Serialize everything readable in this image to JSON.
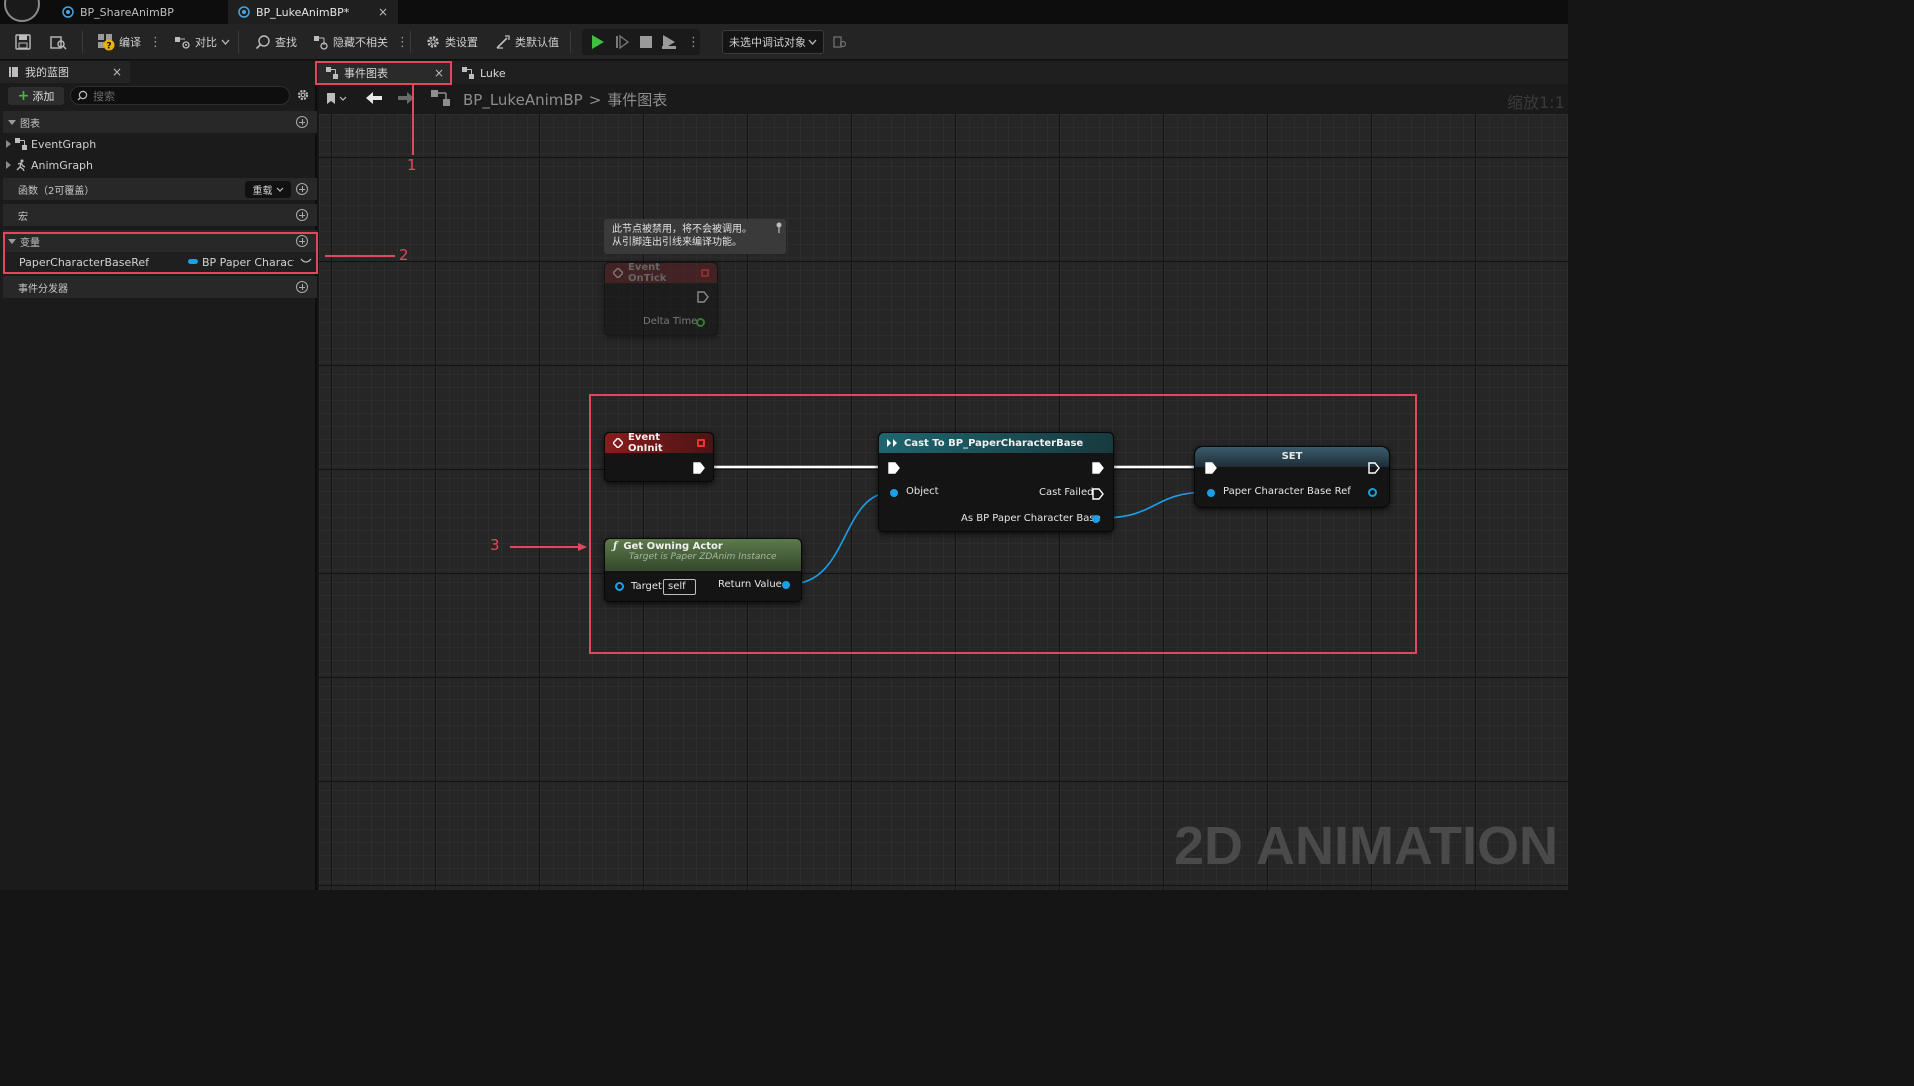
{
  "titlebar": {
    "tabs": [
      {
        "label": "BP_ShareAnimBP"
      },
      {
        "label": "BP_LukeAnimBP*",
        "close": "×"
      }
    ]
  },
  "toolbar": {
    "compile": "编译",
    "diff": "对比",
    "find": "查找",
    "hide_unrelated": "隐藏不相关",
    "class_settings": "类设置",
    "class_defaults": "类默认值",
    "debug_target": "未选中调试对象"
  },
  "my_blueprint": {
    "tab_label": "我的蓝图",
    "tab_close": "×",
    "add_label": "添加",
    "search_placeholder": "搜索",
    "sections": {
      "graphs": "图表",
      "functions": "函数（2可覆盖）",
      "override": "重载",
      "macros": "宏",
      "variables": "变量",
      "dispatchers": "事件分发器"
    },
    "graphs": [
      "EventGraph",
      "AnimGraph"
    ],
    "variable": {
      "name": "PaperCharacterBaseRef",
      "type": "BP Paper Character"
    }
  },
  "graph": {
    "tabs": [
      {
        "label": "事件图表",
        "close": "×"
      },
      {
        "label": "Luke"
      }
    ],
    "breadcrumb": {
      "root": "BP_LukeAnimBP",
      "separator": ">",
      "current": "事件图表"
    },
    "zoom": "缩放1:1",
    "comment": {
      "line1": "此节点被禁用，将不会被调用。",
      "line2": "从引脚连出引线来编译功能。"
    },
    "nodes": {
      "event_ontick": {
        "title": "Event OnTick",
        "pin": "Delta Time"
      },
      "event_oninit": {
        "title": "Event OnInit"
      },
      "get_owning_actor": {
        "title": "Get Owning Actor",
        "subtitle": "Target is Paper ZDAnim Instance",
        "target_label": "Target",
        "target_value": "self",
        "return_label": "Return Value"
      },
      "cast": {
        "title": "Cast To BP_PaperCharacterBase",
        "object_label": "Object",
        "failed_label": "Cast Failed",
        "as_label": "As BP Paper Character Base"
      },
      "set": {
        "title": "SET",
        "pin_label": "Paper Character Base Ref"
      }
    },
    "watermark": "2D ANIMATION"
  },
  "annotations": [
    "1",
    "2",
    "3"
  ],
  "colors": {
    "annotation": "#e2475e",
    "event_header": "#8a1c1c",
    "pure_function_header": "#4a6a3c",
    "cast_header": "#1f5b66",
    "set_header": "#2e4c5c",
    "object_pin": "#1aa0e8"
  }
}
